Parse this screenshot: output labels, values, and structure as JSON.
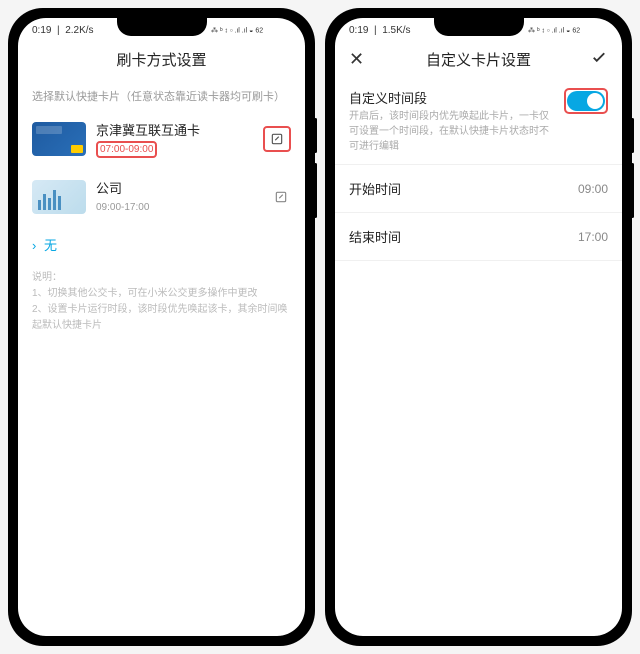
{
  "status": {
    "time": "0:19",
    "speed_left": "2.2K/s",
    "speed_right": "1.5K/s",
    "icons": "⋮ ⁙ ᴮ ⫾ .ıl .ıl ⚡ 62"
  },
  "left": {
    "title": "刷卡方式设置",
    "hint": "选择默认快捷卡片（任意状态靠近读卡器均可刷卡）",
    "cards": [
      {
        "name": "京津冀互联互通卡",
        "time": "07:00-09:00",
        "highlight": true
      },
      {
        "name": "公司",
        "time": "09:00-17:00",
        "highlight": false
      }
    ],
    "none_label": "无",
    "desc_title": "说明：",
    "desc_1": "1、切换其他公交卡，可在小米公交更多操作中更改",
    "desc_2": "2、设置卡片运行时段，该时段优先唤起该卡，其余时间唤起默认快捷卡片"
  },
  "right": {
    "title": "自定义卡片设置",
    "section_title": "自定义时间段",
    "section_sub": "开启后，该时间段内优先唤起此卡片，一卡仅可设置一个时间段，在默认快捷卡片状态时不可进行编辑",
    "start_label": "开始时间",
    "start_val": "09:00",
    "end_label": "结束时间",
    "end_val": "17:00"
  }
}
